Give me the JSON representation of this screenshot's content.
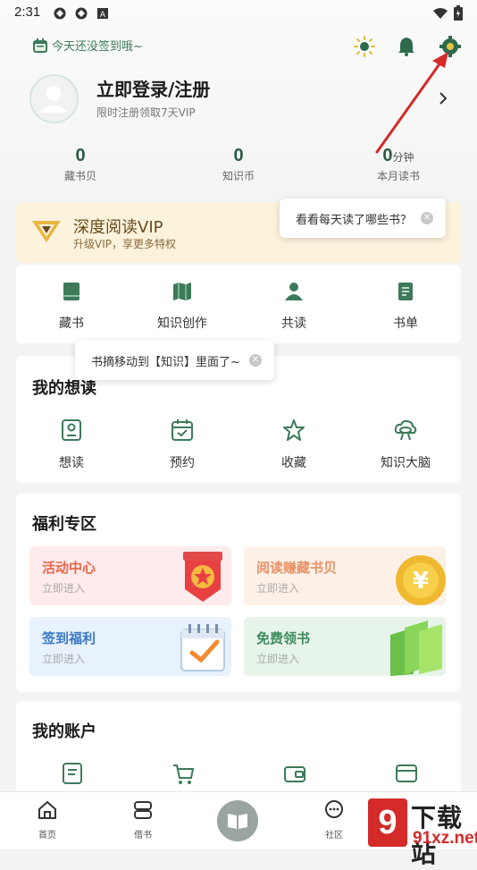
{
  "status_bar": {
    "time": "2:31"
  },
  "header": {
    "signin_text": "今天还没签到哦~",
    "login_title": "立即登录/注册",
    "login_sub": "限时注册领取7天VIP"
  },
  "stats": [
    {
      "value": "0",
      "unit": "",
      "label": "藏书贝"
    },
    {
      "value": "0",
      "unit": "",
      "label": "知识币"
    },
    {
      "value": "0",
      "unit": "分钟",
      "label": "本月读书"
    }
  ],
  "vip": {
    "title": "深度阅读VIP",
    "subtitle": "升级VIP，享更多特权"
  },
  "tooltips": {
    "reading": "看看每天读了哪些书？",
    "notes": "书摘移动到【知识】里面了~"
  },
  "quick_entries": [
    {
      "label": "藏书",
      "icon": "book-icon"
    },
    {
      "label": "知识创作",
      "icon": "map-book-icon"
    },
    {
      "label": "共读",
      "icon": "person-icon"
    },
    {
      "label": "书单",
      "icon": "list-doc-icon"
    }
  ],
  "wish": {
    "title": "我的想读",
    "items": [
      {
        "label": "想读",
        "icon": "portrait-card-icon"
      },
      {
        "label": "预约",
        "icon": "calendar-check-icon"
      },
      {
        "label": "收藏",
        "icon": "star-icon"
      },
      {
        "label": "知识大脑",
        "icon": "brain-cloud-icon"
      }
    ]
  },
  "welfare": {
    "title": "福利专区",
    "cards": [
      {
        "title": "活动中心",
        "sub": "立即进入",
        "color": "#e8664a",
        "bg": "#fdeceb"
      },
      {
        "title": "阅读赚藏书贝",
        "sub": "立即进入",
        "color": "#e89268",
        "bg": "#fdf0e6"
      },
      {
        "title": "签到福利",
        "sub": "立即进入",
        "color": "#3a78c4",
        "bg": "#e7f2fd"
      },
      {
        "title": "免费领书",
        "sub": "立即进入",
        "color": "#3d8a5c",
        "bg": "#e6f4ea"
      }
    ]
  },
  "account": {
    "title": "我的账户"
  },
  "nav": [
    {
      "label": "首页",
      "icon": "home-icon"
    },
    {
      "label": "借书",
      "icon": "stack-icon"
    },
    {
      "label": "",
      "icon": "open-book-icon"
    },
    {
      "label": "社区",
      "icon": "chat-icon"
    }
  ],
  "watermark": {
    "mark": "9",
    "cn": "下载站",
    "en": "91xz.net"
  },
  "colors": {
    "accent": "#2d5a44",
    "vip_bg": "#fdf2dc",
    "arrow": "#d42a2a"
  }
}
